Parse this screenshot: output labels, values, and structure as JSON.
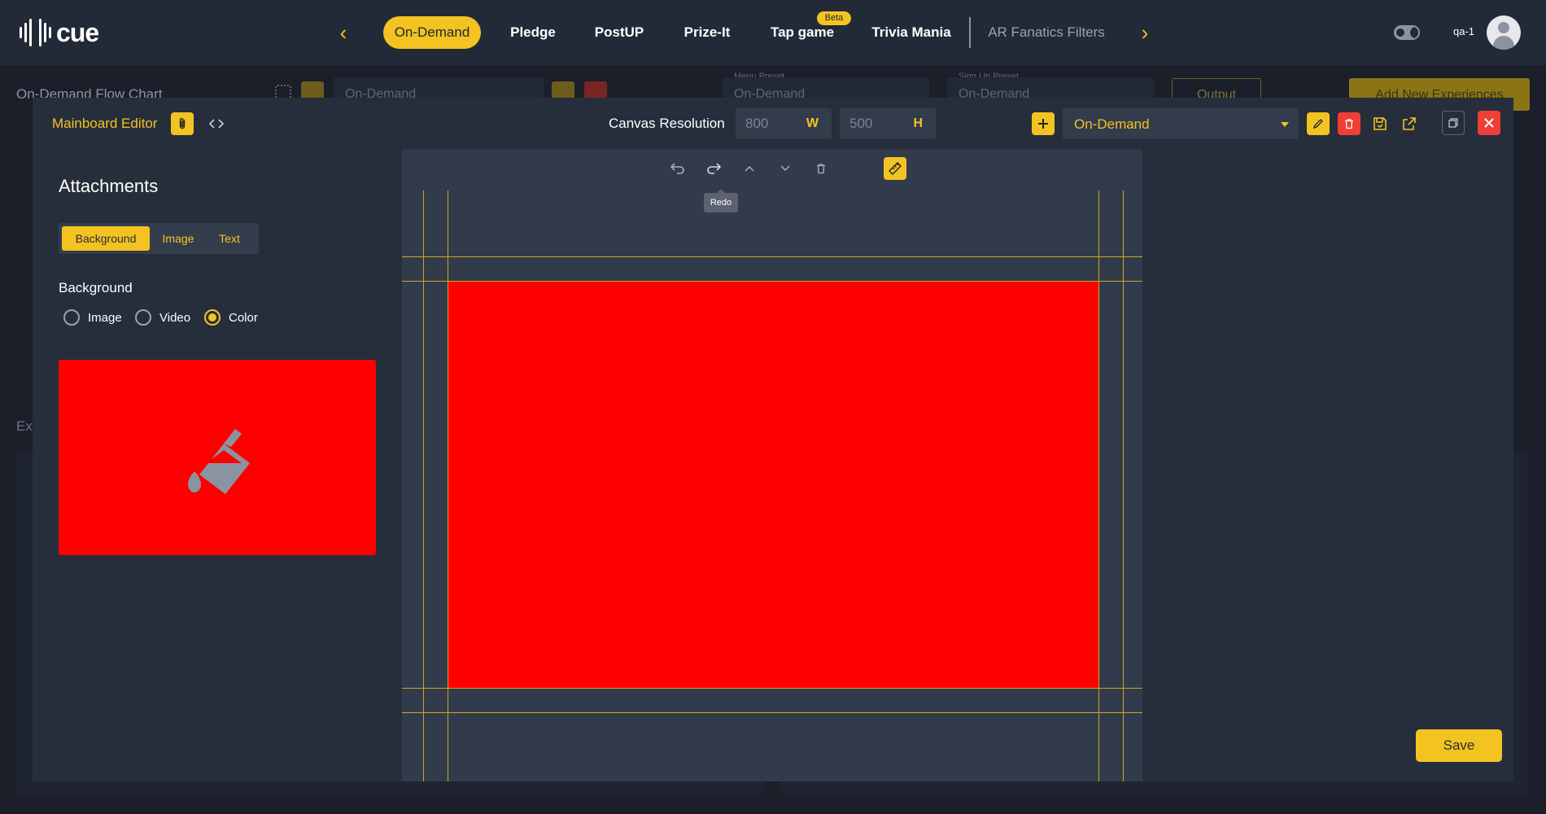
{
  "app": {
    "logo_text": "cue",
    "user": "qa-1"
  },
  "nav": {
    "tabs": [
      {
        "label": "On-Demand",
        "active": true
      },
      {
        "label": "Pledge"
      },
      {
        "label": "PostUP"
      },
      {
        "label": "Prize-It"
      },
      {
        "label": "Tap game",
        "badge": "Beta"
      },
      {
        "label": "Trivia Mania"
      },
      {
        "label": "AR Fanatics Filters"
      }
    ]
  },
  "background_page": {
    "title": "On-Demand Flow Chart",
    "flow_select": "On-Demand",
    "menu_preset_label": "Menu Preset",
    "menu_preset_value": "On-Demand",
    "signup_preset_label": "Sign Up Preset",
    "signup_preset_value": "On-Demand",
    "output_label": "Output",
    "add_button": "Add New Experiences",
    "section_label": "Exp"
  },
  "editor": {
    "title": "Mainboard Editor",
    "canvas_resolution_label": "Canvas Resolution",
    "width": "800",
    "width_unit": "W",
    "height": "500",
    "height_unit": "H",
    "preset": "On-Demand",
    "tooltip": "Redo",
    "save_label": "Save"
  },
  "attachments": {
    "heading": "Attachments",
    "tabs": [
      "Background",
      "Image",
      "Text"
    ],
    "active_tab": "Background",
    "background_label": "Background",
    "options": [
      "Image",
      "Video",
      "Color"
    ],
    "selected_option": "Color",
    "color": "#ff0000"
  },
  "colors": {
    "accent": "#f3c322",
    "danger": "#ef3e36",
    "canvas_fill": "#ff0000"
  }
}
